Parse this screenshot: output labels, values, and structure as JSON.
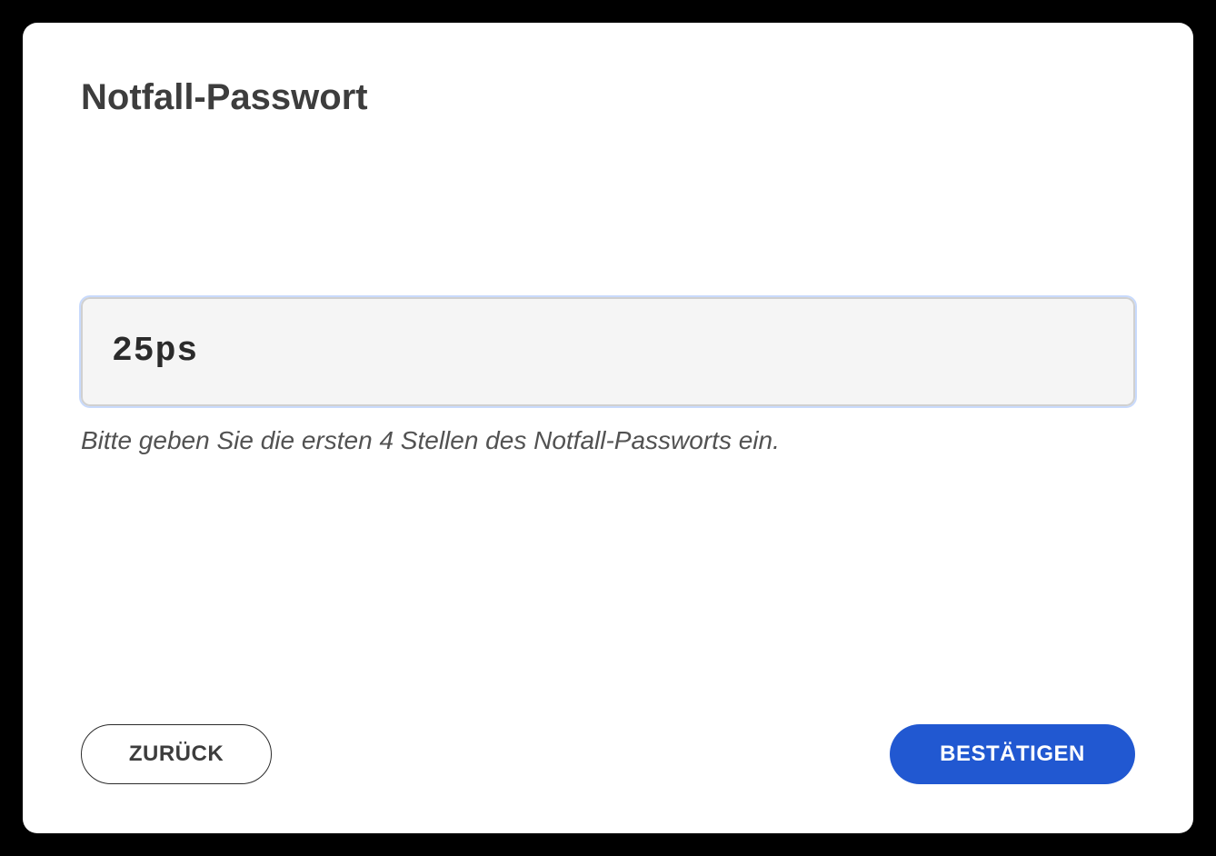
{
  "dialog": {
    "title": "Notfall-Passwort",
    "input_value": "25ps",
    "helper_text": "Bitte geben Sie die ersten 4 Stellen des Notfall-Passworts ein.",
    "back_label": "ZURÜCK",
    "confirm_label": "BESTÄTIGEN"
  }
}
